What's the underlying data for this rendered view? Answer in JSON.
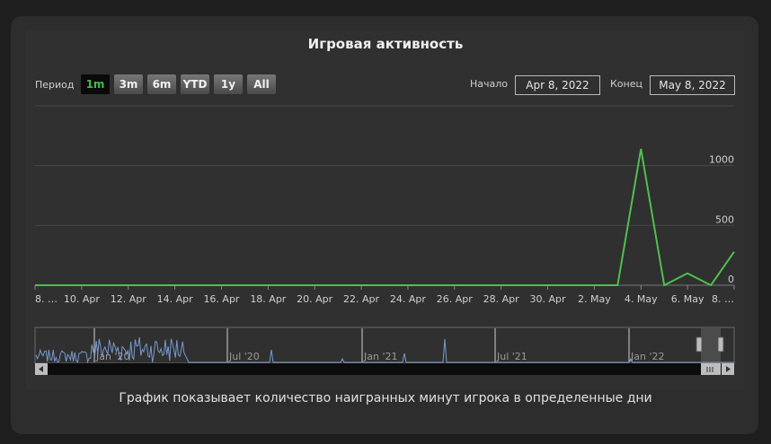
{
  "title": "Игровая активность",
  "period_label": "Период",
  "range_buttons": [
    "1m",
    "3m",
    "6m",
    "YTD",
    "1y",
    "All"
  ],
  "active_range": "1m",
  "start_label": "Начало",
  "start_value": "Apr 8, 2022",
  "end_label": "Конец",
  "end_value": "May 8, 2022",
  "footer": "График показывает количество наигранных минут игрока в определенные дни",
  "colors": {
    "series": "#4fc04f",
    "navigator": "#7799cc",
    "active_button_text": "#3fbf4a"
  },
  "chart_data": {
    "type": "line",
    "title": "Игровая активность",
    "x": [
      "2022-04-08",
      "2022-04-09",
      "2022-04-10",
      "2022-04-11",
      "2022-04-12",
      "2022-04-13",
      "2022-04-14",
      "2022-04-15",
      "2022-04-16",
      "2022-04-17",
      "2022-04-18",
      "2022-04-19",
      "2022-04-20",
      "2022-04-21",
      "2022-04-22",
      "2022-04-23",
      "2022-04-24",
      "2022-04-25",
      "2022-04-26",
      "2022-04-27",
      "2022-04-28",
      "2022-04-29",
      "2022-04-30",
      "2022-05-01",
      "2022-05-02",
      "2022-05-03",
      "2022-05-04",
      "2022-05-05",
      "2022-05-06",
      "2022-05-07",
      "2022-05-08"
    ],
    "series": [
      {
        "values": [
          0,
          0,
          0,
          0,
          0,
          0,
          0,
          0,
          0,
          0,
          0,
          0,
          0,
          0,
          0,
          0,
          0,
          0,
          0,
          0,
          0,
          0,
          0,
          0,
          0,
          0,
          1140,
          0,
          100,
          0,
          280
        ]
      }
    ],
    "x_tick_labels": [
      "8. …",
      "10. Apr",
      "12. Apr",
      "14. Apr",
      "16. Apr",
      "18. Apr",
      "20. Apr",
      "22. Apr",
      "24. Apr",
      "26. Apr",
      "28. Apr",
      "30. Apr",
      "2. May",
      "4. May",
      "6. May",
      "8. …"
    ],
    "y_tick_labels": [
      "0",
      "500",
      "1000"
    ],
    "ylim": [
      0,
      1500
    ],
    "grid": true,
    "navigator_labels": [
      "Jan '20",
      "Jul '20",
      "Jan '21",
      "Jul '21",
      "Jan '22"
    ]
  }
}
